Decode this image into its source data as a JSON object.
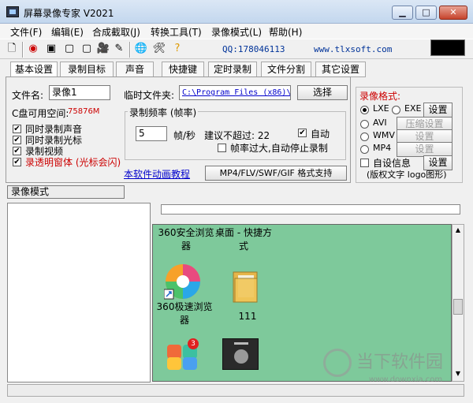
{
  "window": {
    "title": "屏幕录像专家 V2021"
  },
  "menu": [
    "文件(F)",
    "编辑(E)",
    "合成截取(J)",
    "转换工具(T)",
    "录像模式(L)",
    "帮助(H)"
  ],
  "toolbar": {
    "qq": "QQ:178046113",
    "site": "www.tlxsoft.com"
  },
  "tabs": [
    "基本设置",
    "录制目标",
    "声音",
    "快捷键",
    "定时录制",
    "文件分割",
    "其它设置"
  ],
  "basic": {
    "filename_label": "文件名:",
    "filename_value": "录像1",
    "tempdir_label": "临时文件夹:",
    "tempdir_value": "C:\\Program Files (x86)\\",
    "select_button": "选择",
    "disk_label": "C盘可用空间:",
    "disk_value": "75876M",
    "checks": [
      "同时录制声音",
      "同时录制光标",
      "录制视频",
      "录透明窗体 (光标会闪)"
    ],
    "framerate_group": "录制频率 (帧率)",
    "fps_value": "5",
    "fps_unit": "帧/秒",
    "suggest_label": "建议不超过: 22",
    "auto_label": "自动",
    "stop_label": "帧率过大,自动停止录制",
    "tutorial_link": "本软件动画教程",
    "format_support": "MP4/FLV/SWF/GIF  格式支持"
  },
  "format_panel": {
    "title": "录像格式:",
    "lxe": "LXE",
    "exe": "EXE",
    "settings": "设置",
    "avi": "AVI",
    "compress_settings": "压缩设置",
    "wmv": "WMV",
    "mp4": "MP4",
    "custom_info": "自设信息",
    "copyright_note": "(版权文字 logo图形)"
  },
  "mode_tab": "录像模式",
  "desktop": {
    "items": [
      {
        "label": "360安全浏览器"
      },
      {
        "label": "桌面 - 快捷方式"
      },
      {
        "label": "360极速浏览器"
      },
      {
        "label": "111"
      }
    ],
    "icon_badge": "3"
  },
  "watermark": {
    "text": "当下软件园",
    "url": "www.downxia.com"
  },
  "colors": {
    "accent_red": "#cc0000",
    "link_blue": "#0000cc",
    "preview_bg": "#7ec99b"
  }
}
